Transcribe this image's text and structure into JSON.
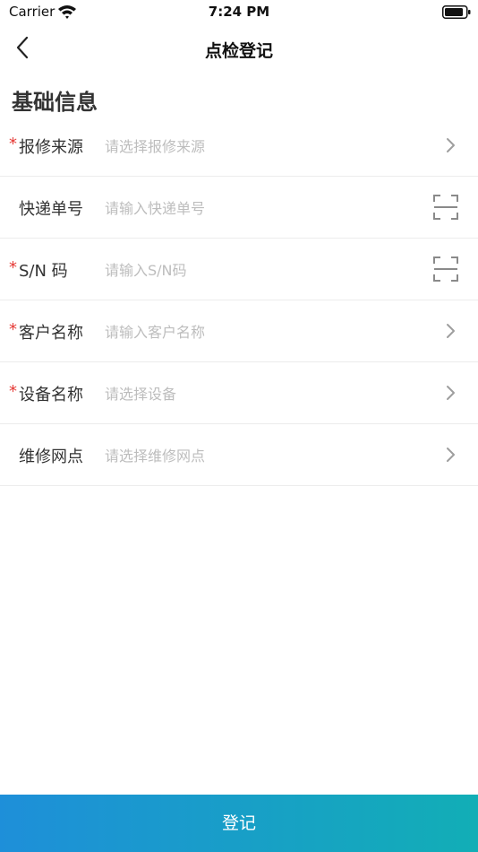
{
  "status_bar": {
    "carrier": "Carrier",
    "time": "7:24 PM"
  },
  "nav": {
    "title": "点检登记"
  },
  "section": {
    "title": "基础信息"
  },
  "form": {
    "rows": [
      {
        "label": "报修来源",
        "required": true,
        "placeholder": "请选择报修来源",
        "action": "chevron"
      },
      {
        "label": "快递单号",
        "required": false,
        "placeholder": "请输入快递单号",
        "action": "scan"
      },
      {
        "label": "S/N 码",
        "required": true,
        "placeholder": "请输入S/N码",
        "action": "scan"
      },
      {
        "label": "客户名称",
        "required": true,
        "placeholder": "请输入客户名称",
        "action": "chevron"
      },
      {
        "label": "设备名称",
        "required": true,
        "placeholder": "请选择设备",
        "action": "chevron"
      },
      {
        "label": "维修网点",
        "required": false,
        "placeholder": "请选择维修网点",
        "action": "chevron"
      }
    ],
    "required_mark": "*"
  },
  "submit": {
    "label": "登记"
  },
  "colors": {
    "required": "#e53935",
    "gradient_start": "#1e8fd9",
    "gradient_end": "#12aeb6",
    "placeholder": "#bdbdbd"
  }
}
